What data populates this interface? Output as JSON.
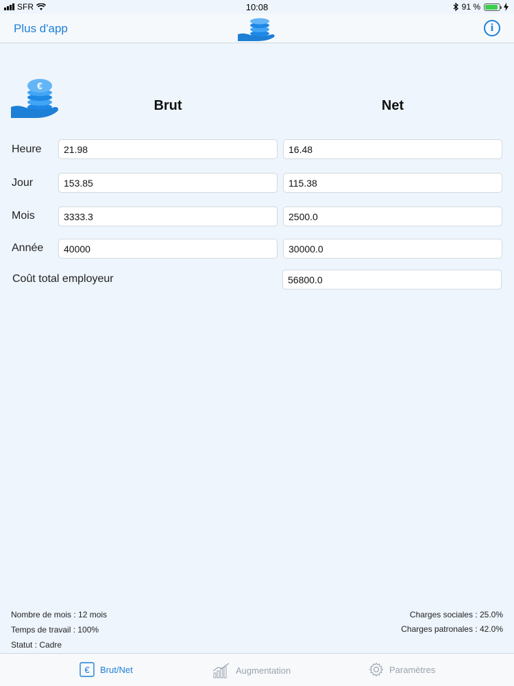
{
  "status_bar": {
    "carrier": "SFR",
    "time": "10:08",
    "battery": "91 %",
    "battery_level": 0.91,
    "icons": [
      "signal-icon",
      "wifi-icon",
      "bluetooth-icon",
      "battery-icon",
      "charging-icon"
    ]
  },
  "nav": {
    "left_button": "Plus d'app",
    "logo_icon": "coins-hand-icon",
    "right_icon": "info-icon"
  },
  "header": {
    "logo_icon": "coins-hand-icon",
    "col_brut": "Brut",
    "col_net": "Net"
  },
  "rows": [
    {
      "label": "Heure",
      "brut": "21.98",
      "net": "16.48"
    },
    {
      "label": "Jour",
      "brut": "153.85",
      "net": "115.38"
    },
    {
      "label": "Mois",
      "brut": "3333.3",
      "net": "2500.0"
    },
    {
      "label": "Année",
      "brut": "40000",
      "net": "30000.0"
    }
  ],
  "cout": {
    "label": "Coût total employeur",
    "value": "56800.0"
  },
  "footer": {
    "left": [
      "Nombre de mois : 12 mois",
      "Temps de travail : 100%",
      "Statut : Cadre"
    ],
    "right": [
      "Charges sociales : 25.0%",
      "Charges patronales : 42.0%"
    ]
  },
  "tabs": [
    {
      "label": "Brut/Net",
      "icon": "euro-icon",
      "active": true
    },
    {
      "label": "Augmentation",
      "icon": "growth-chart-icon",
      "active": false
    },
    {
      "label": "Paramètres",
      "icon": "gear-icon",
      "active": false
    }
  ],
  "colors": {
    "accent": "#1e7fd6",
    "background": "#eef5fc",
    "inactive": "#9aa3ad"
  }
}
